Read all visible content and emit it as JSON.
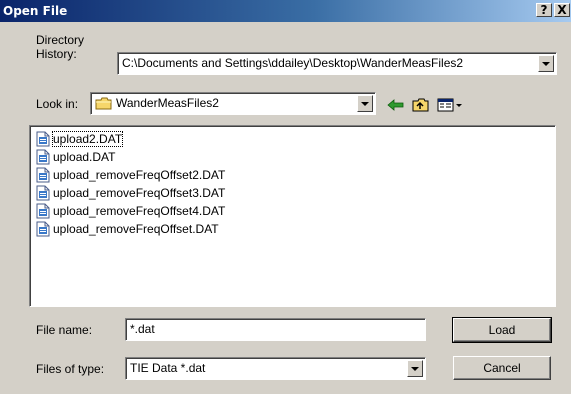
{
  "window": {
    "title": "Open File",
    "help_label": "?",
    "close_label": "X"
  },
  "directory_history": {
    "label_line1": "Directory",
    "label_line2": "History:",
    "value": "C:\\Documents and Settings\\ddailey\\Desktop\\WanderMeasFiles2"
  },
  "look_in": {
    "label": "Look in:",
    "value": "WanderMeasFiles2",
    "folder_icon": "folder-icon"
  },
  "toolbar": {
    "back_icon": "back-arrow-icon",
    "up_icon": "up-folder-icon",
    "view_icon": "view-menu-icon"
  },
  "files": [
    {
      "name": "upload2.DAT",
      "selected": true
    },
    {
      "name": "upload.DAT",
      "selected": false
    },
    {
      "name": "upload_removeFreqOffset2.DAT",
      "selected": false
    },
    {
      "name": "upload_removeFreqOffset3.DAT",
      "selected": false
    },
    {
      "name": "upload_removeFreqOffset4.DAT",
      "selected": false
    },
    {
      "name": "upload_removeFreqOffset.DAT",
      "selected": false
    }
  ],
  "file_name": {
    "label": "File name:",
    "value": "*.dat"
  },
  "file_type": {
    "label": "Files of type:",
    "value": "TIE Data *.dat"
  },
  "buttons": {
    "load": "Load",
    "cancel": "Cancel"
  }
}
